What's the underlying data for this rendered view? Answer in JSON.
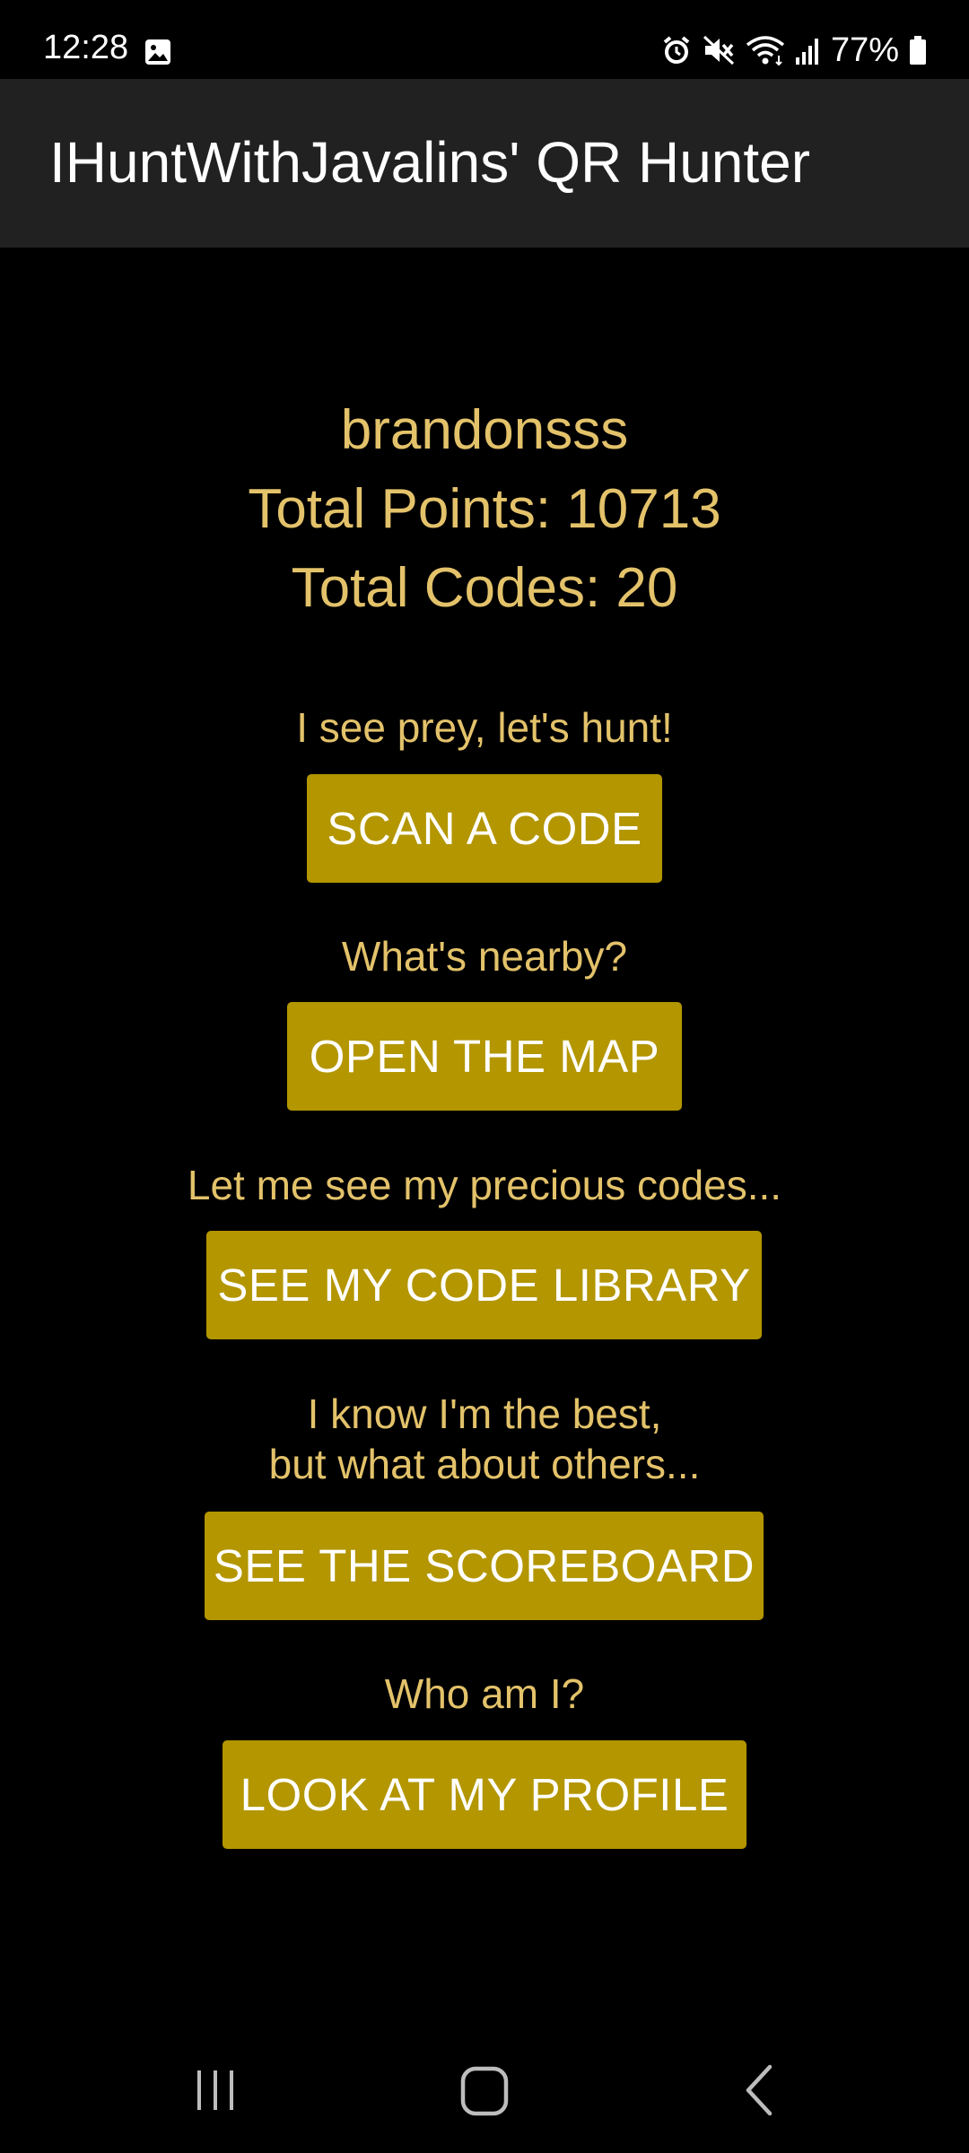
{
  "status_bar": {
    "time": "12:28",
    "battery": "77%",
    "icons": [
      "gallery-icon",
      "alarm-icon",
      "mute-icon",
      "wifi-icon",
      "signal-icon",
      "battery-icon"
    ]
  },
  "app_bar": {
    "title": "IHuntWithJavalins' QR Hunter"
  },
  "profile": {
    "username": "brandonsss",
    "total_points": "Total Points: 10713",
    "total_codes": "Total Codes: 20"
  },
  "actions": {
    "scan": {
      "prompt": "I see prey, let's hunt!",
      "button": "SCAN A CODE"
    },
    "map": {
      "prompt": "What's nearby?",
      "button": "OPEN THE MAP"
    },
    "library": {
      "prompt": "Let me see my precious codes...",
      "button": "SEE MY CODE LIBRARY"
    },
    "scoreboard": {
      "prompt_line1": "I know I'm the best,",
      "prompt_line2": "but what about others...",
      "button": "SEE THE SCOREBOARD"
    },
    "profile": {
      "prompt": "Who am I?",
      "button": "LOOK AT MY PROFILE"
    }
  },
  "nav_bar": {
    "icons": [
      "recent-apps-icon",
      "home-icon",
      "back-icon"
    ]
  },
  "colors": {
    "background": "#000000",
    "app_bar": "#212121",
    "accent_text": "#e3c26a",
    "button": "#b39600",
    "button_text": "#ffffff"
  }
}
